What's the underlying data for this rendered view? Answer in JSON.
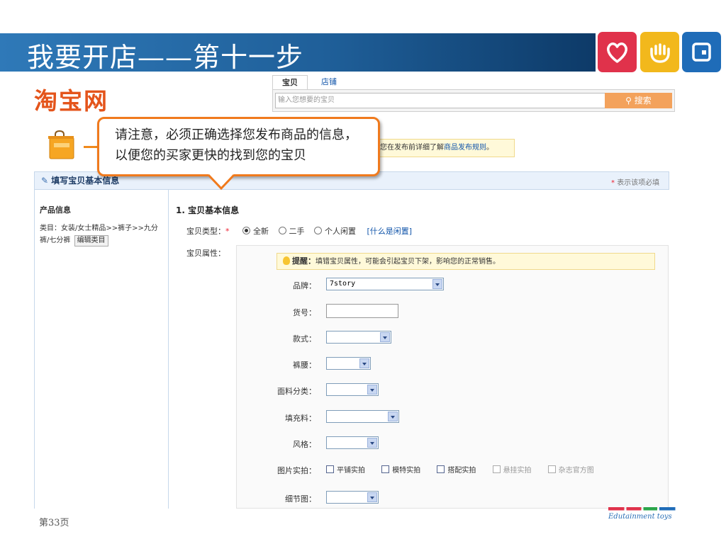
{
  "slide": {
    "title": "我要开店——第十一步",
    "page_number": "第33页",
    "brand_tagline": "Edutainment toys",
    "icons": [
      {
        "name": "heart-icon",
        "color": "#e0324b"
      },
      {
        "name": "hand-icon",
        "color": "#f2b81c"
      },
      {
        "name": "square-icon",
        "color": "#1f6cb8"
      }
    ]
  },
  "taobao": {
    "logo": "淘宝网",
    "search": {
      "tabs": [
        "宝贝",
        "店铺"
      ],
      "placeholder": "输入您想要的宝贝",
      "button": "搜索"
    },
    "notice": {
      "text": "您在发布前详细了解",
      "link": "商品发布规则",
      "end": "。"
    },
    "callout": {
      "line1": "请注意，必须正确选择您发布商品的信息，",
      "line2": "以便您的买家更快的找到您的宝贝"
    },
    "form": {
      "title": "填写宝贝基本信息",
      "required_hint": "表示该项必填",
      "product_info_title": "产品信息",
      "category": "类目：女装/女士精品>>裤子>>九分裤/七分裤",
      "edit_category": "编辑类目",
      "section_title": "1. 宝贝基本信息",
      "type_label": "宝贝类型：",
      "type_options": [
        "全新",
        "二手",
        "个人闲置"
      ],
      "type_selected": "全新",
      "what_link": "[什么是闲置]",
      "attr_label": "宝贝属性：",
      "tip_title": "提醒：",
      "tip_text": "填错宝贝属性，可能会引起宝贝下架，影响您的正常销售。",
      "fields": {
        "brand": {
          "label": "品牌：",
          "value": "7story"
        },
        "item_no": {
          "label": "货号："
        },
        "style": {
          "label": "款式："
        },
        "waist": {
          "label": "裤腰："
        },
        "fabric": {
          "label": "面料分类："
        },
        "filling": {
          "label": "填充料："
        },
        "fashion": {
          "label": "风格："
        },
        "photo": {
          "label": "图片实拍：",
          "options": [
            "平铺实拍",
            "模特实拍",
            "搭配实拍",
            "悬挂实拍",
            "杂志官方图"
          ]
        },
        "detail": {
          "label": "细节图："
        }
      }
    }
  }
}
